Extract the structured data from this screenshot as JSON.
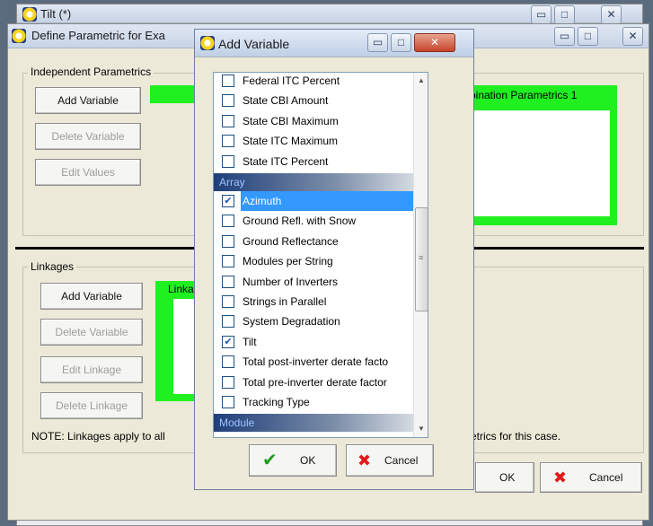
{
  "tilt_window": {
    "title": "Tilt (*)"
  },
  "define_window": {
    "title": "Define Parametric for Exa",
    "independent": {
      "group_label": "Independent Parametrics",
      "add_variable": "Add Variable",
      "delete_variable": "Delete Variable",
      "edit_values": "Edit Values",
      "combination_label": "mbination Parametrics 1"
    },
    "linkages": {
      "group_label": "Linkages",
      "add_variable": "Add Variable",
      "delete_variable": "Delete Variable",
      "edit_linkage": "Edit Linkage",
      "delete_linkage": "Delete Linkage",
      "linkages_label": "Linka",
      "note_left": "NOTE: Linkages apply to all",
      "note_right": "etrics for this case."
    },
    "ok": "OK",
    "cancel": "Cancel"
  },
  "add_variable_dialog": {
    "title": "Add Variable",
    "items_top": [
      {
        "label": "Federal ITC Percent",
        "checked": false
      },
      {
        "label": "State CBI Amount",
        "checked": false
      },
      {
        "label": "State CBI Maximum",
        "checked": false
      },
      {
        "label": "State ITC Maximum",
        "checked": false
      },
      {
        "label": "State ITC Percent",
        "checked": false
      }
    ],
    "section_array": "Array",
    "items_array": [
      {
        "label": "Azimuth",
        "checked": true
      },
      {
        "label": "Ground Refl. with Snow",
        "checked": false
      },
      {
        "label": "Ground Reflectance",
        "checked": false
      },
      {
        "label": "Modules per String",
        "checked": false
      },
      {
        "label": "Number of Inverters",
        "checked": false
      },
      {
        "label": "Strings in Parallel",
        "checked": false
      },
      {
        "label": "System Degradation",
        "checked": false
      },
      {
        "label": "Tilt",
        "checked": true
      },
      {
        "label": "Total post-inverter derate facto",
        "checked": false
      },
      {
        "label": "Total pre-inverter derate factor",
        "checked": false
      },
      {
        "label": "Tracking Type",
        "checked": false
      }
    ],
    "section_module": "Module",
    "ok": "OK",
    "cancel": "Cancel"
  },
  "icons": {
    "check": "✔",
    "cross": "✖",
    "minimize": "▭",
    "maximize": "□",
    "close": "✕"
  },
  "colors": {
    "green": "#20f020",
    "selection": "#3399ff",
    "ok_check": "#1f9a1f",
    "cancel_x": "#e01a1a"
  }
}
